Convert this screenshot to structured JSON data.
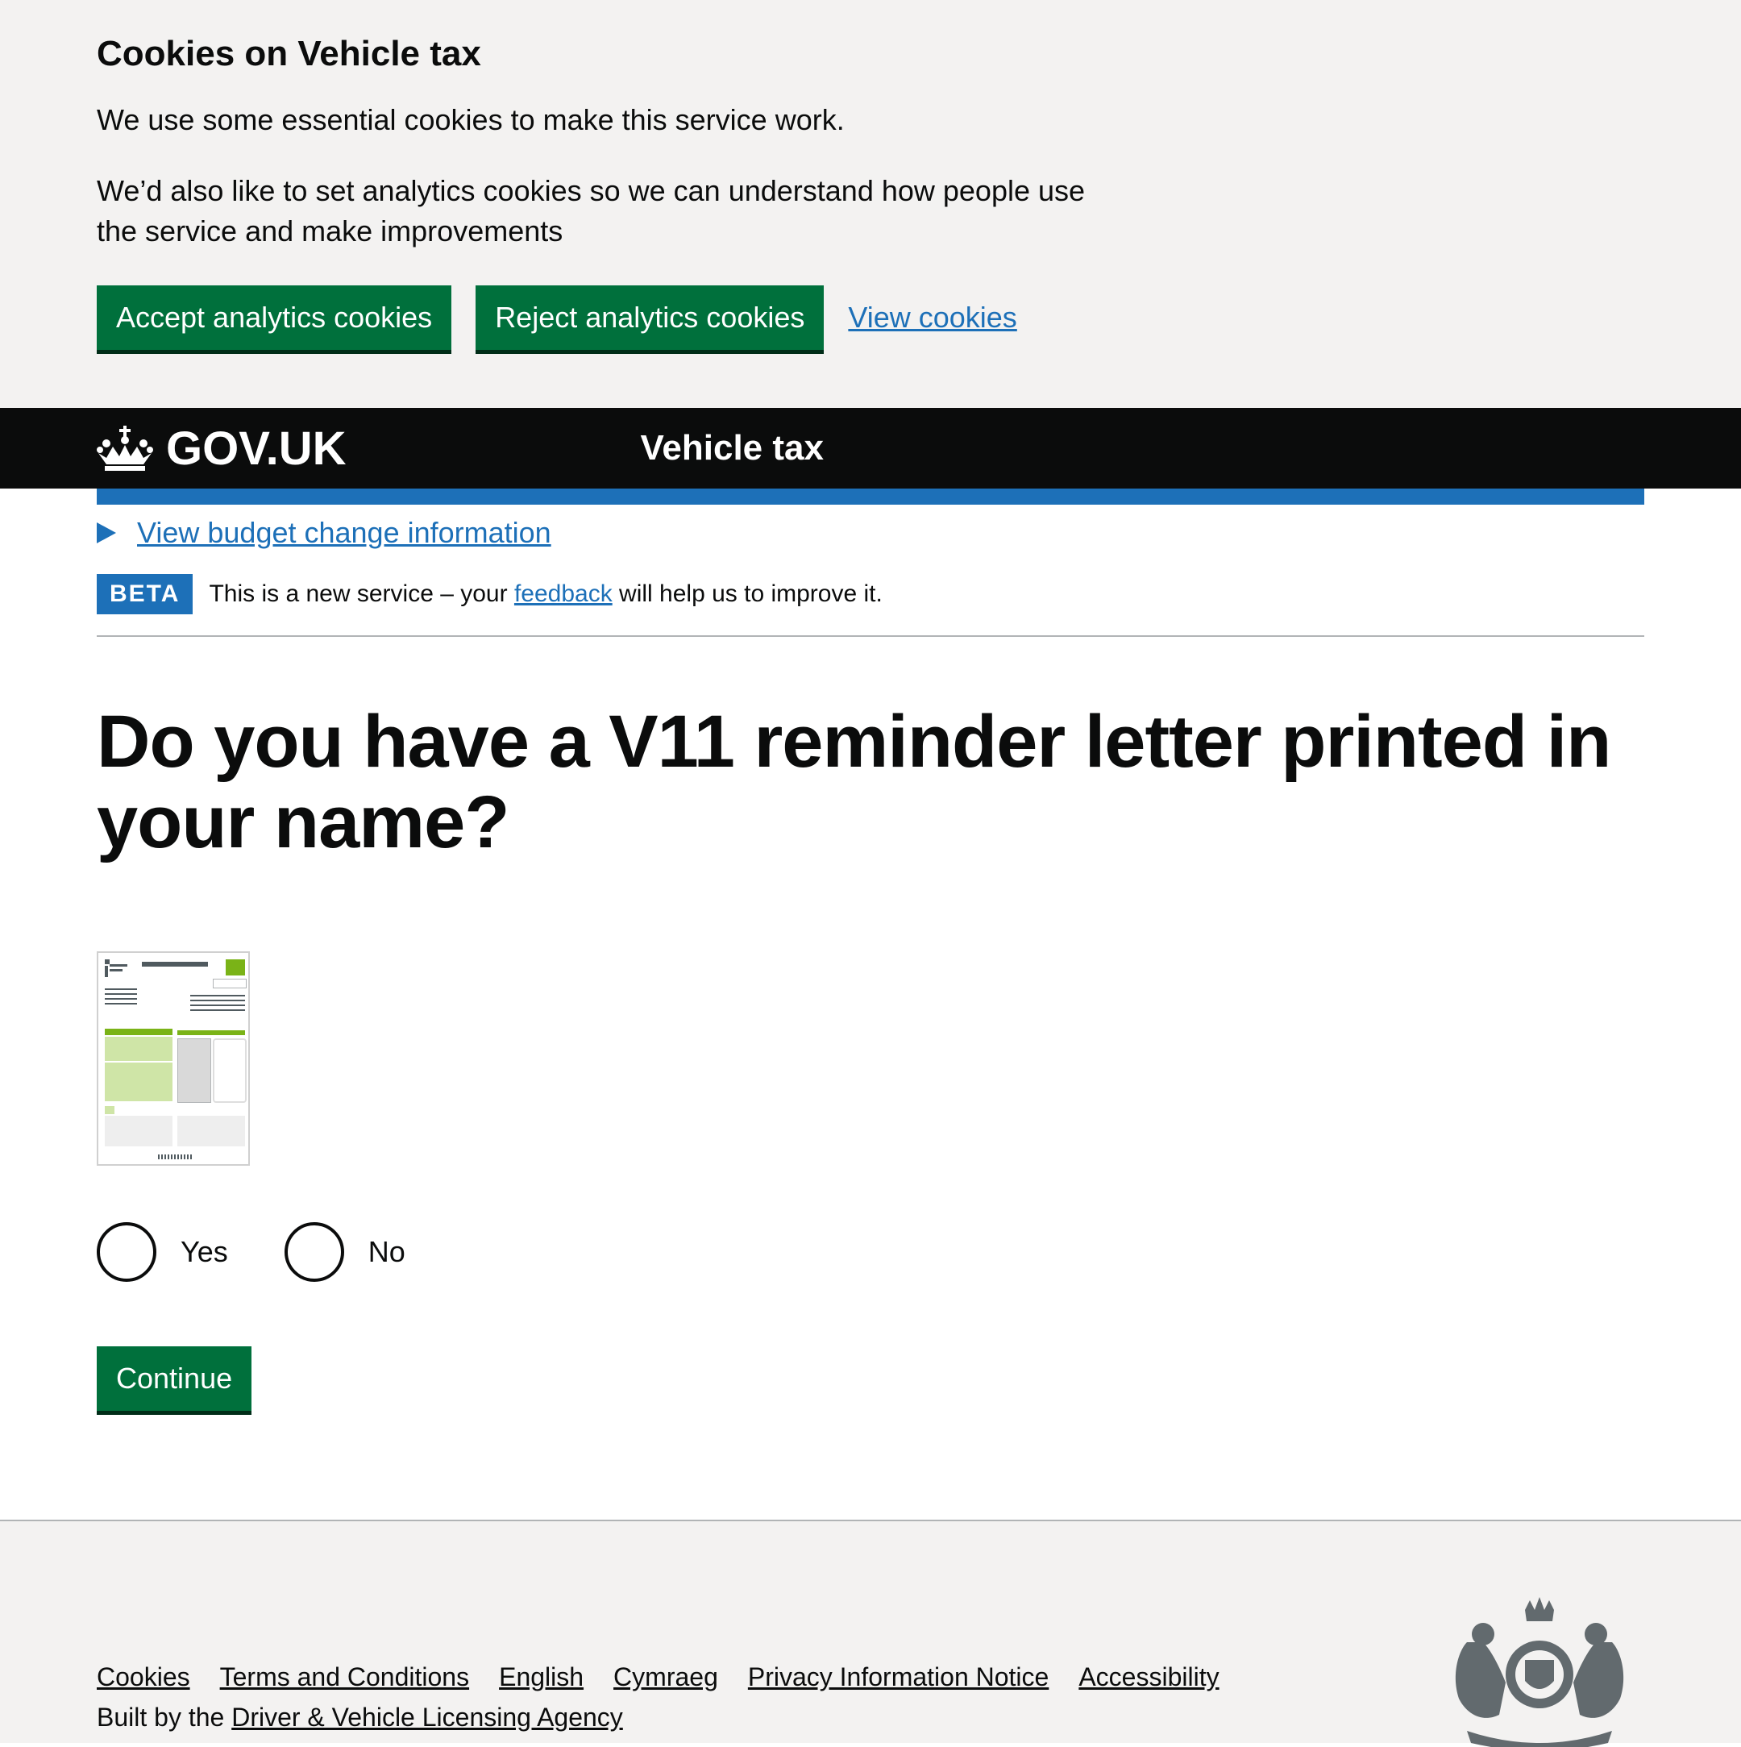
{
  "cookie_banner": {
    "title": "Cookies on Vehicle tax",
    "para1": "We use some essential cookies to make this service work.",
    "para2": "We’d also like to set analytics cookies so we can understand how people use the service and make improvements",
    "accept_label": "Accept analytics cookies",
    "reject_label": "Reject analytics cookies",
    "view_label": "View cookies"
  },
  "header": {
    "logo_text": "GOV.UK",
    "service_name": "Vehicle tax"
  },
  "budget_link": "View budget change information",
  "phase_banner": {
    "tag": "BETA",
    "text_before": "This is a new service – your ",
    "link": "feedback",
    "text_after": " will help us to improve it."
  },
  "question": {
    "heading": "Do you have a V11 reminder letter printed in your name?",
    "options": [
      "Yes",
      "No"
    ],
    "continue_label": "Continue"
  },
  "footer": {
    "links": [
      "Cookies",
      "Terms and Conditions",
      "English",
      "Cymraeg",
      "Privacy Information Notice",
      "Accessibility"
    ],
    "built_by_prefix": "Built by the ",
    "built_by_link": "Driver & Vehicle Licensing Agency"
  },
  "colors": {
    "green": "#00703c",
    "blue": "#1d70b8",
    "black": "#0b0c0c",
    "grey_bg": "#f3f2f1"
  }
}
